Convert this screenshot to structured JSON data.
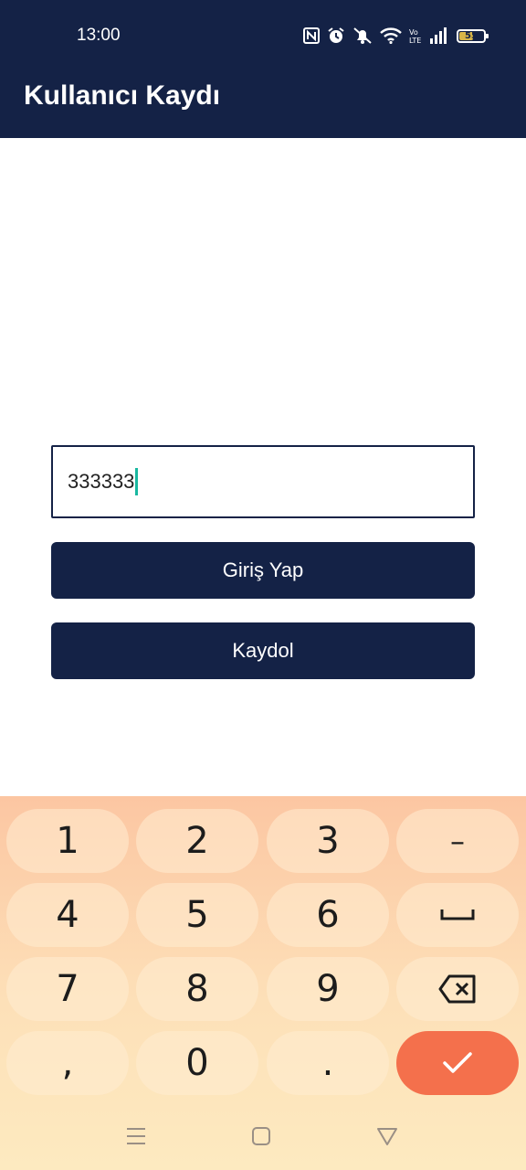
{
  "status_bar": {
    "time": "13:00",
    "battery_level": "55",
    "icons": [
      "nfc-icon",
      "alarm-icon",
      "mute-icon",
      "wifi-icon",
      "volte-icon",
      "signal-icon",
      "battery-icon"
    ]
  },
  "app_bar": {
    "title": "Kullanıcı Kaydı"
  },
  "form": {
    "input_value": "333333",
    "login_label": "Giriş Yap",
    "register_label": "Kaydol"
  },
  "keyboard": {
    "rows": [
      [
        "1",
        "2",
        "3",
        "–"
      ],
      [
        "4",
        "5",
        "6",
        "space"
      ],
      [
        "7",
        "8",
        "9",
        "backspace"
      ],
      [
        ",",
        "0",
        ".",
        "done"
      ]
    ],
    "keys": {
      "k1": "1",
      "k2": "2",
      "k3": "3",
      "dash": "–",
      "k4": "4",
      "k5": "5",
      "k6": "6",
      "k7": "7",
      "k8": "8",
      "k9": "9",
      "comma": ",",
      "k0": "0",
      "dot": "."
    },
    "enter_color": "#f4704c"
  },
  "colors": {
    "primary": "#142246",
    "accent_caret": "#19b8a0",
    "keyboard_top": "#fcc6a2",
    "keyboard_bottom": "#fdeac0"
  },
  "nav_bar": {
    "icons": [
      "menu-icon",
      "home-icon",
      "back-icon"
    ]
  }
}
